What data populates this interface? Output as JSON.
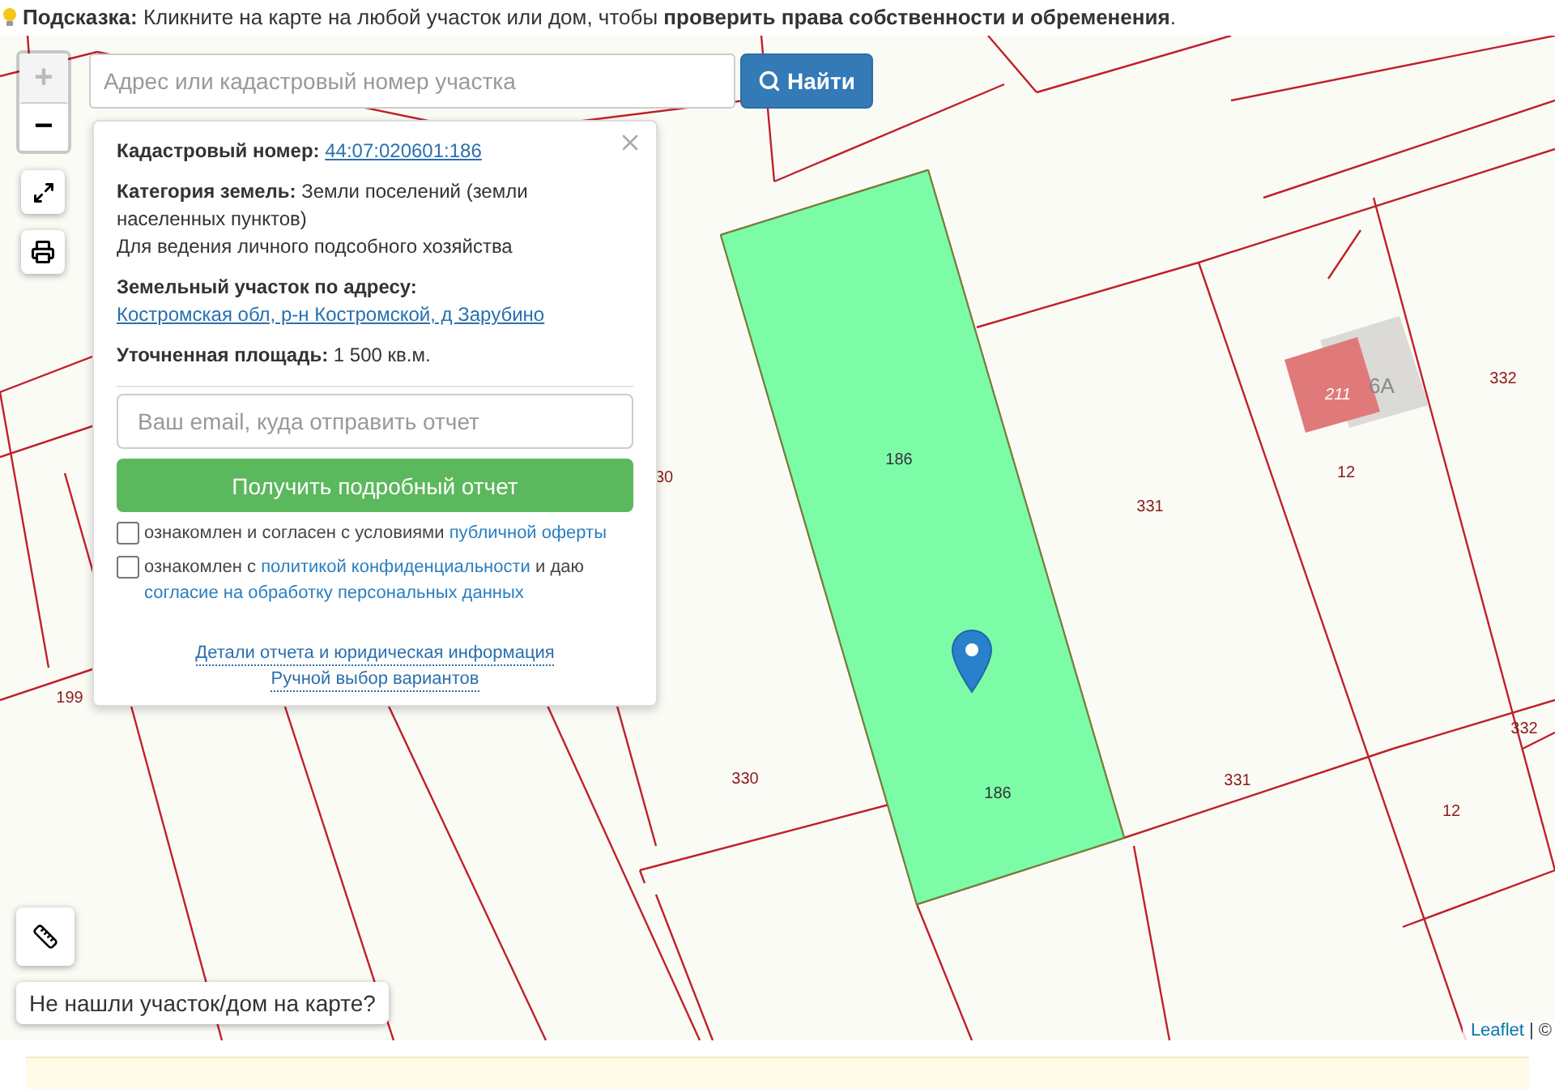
{
  "hint": {
    "text": "**Подсказка:** Кликните на карте на любой участок или дом, чтобы **проверить права собственности и обременения**."
  },
  "search": {
    "placeholder": "Адрес или кадастровый номер участка",
    "button": "Найти"
  },
  "zoom": {
    "in": "+",
    "out": "−"
  },
  "popup": {
    "cadastral_label": "Кадастровый номер:",
    "cadastral_number": "44:07:020601:186",
    "category": "**Категория земель:** Земли поселений (земли населенных пунктов)",
    "usage": "Для ведения личного подсобного хозяйства",
    "address_label": "Земельный участок по адресу:",
    "address": "Костромская обл, р-н Костромской, д Зарубино",
    "area": "**Уточненная площадь:** 1 500 кв.м.",
    "email_placeholder": "Ваш email, куда отправить отчет",
    "submit": "Получить подробный отчет",
    "consents": [
      {
        "checked": false,
        "parts": [
          {
            "kind": "text",
            "text": "ознакомлен и согласен с условиями "
          },
          {
            "kind": "link",
            "text": "публичной оферты"
          }
        ]
      },
      {
        "checked": false,
        "parts": [
          {
            "kind": "text",
            "text": "ознакомлен с "
          },
          {
            "kind": "link",
            "text": "политикой конфиденциальности"
          },
          {
            "kind": "text",
            "text": " и даю "
          },
          {
            "kind": "link",
            "text": "согласие на обработку персональных данных"
          }
        ]
      }
    ],
    "links": [
      "Детали отчета и юридическая информация",
      "Ручной выбор вариантов"
    ]
  },
  "parcel_labels": [
    "186",
    "186",
    "331",
    "331",
    "330",
    "30",
    "199",
    "12",
    "12",
    "332",
    "332"
  ],
  "building": {
    "number": "211",
    "behind": "6А"
  },
  "not_found": "Не нашли участок/дом на карте?",
  "attribution": {
    "link": "Leaflet",
    "rest": "| ©"
  }
}
